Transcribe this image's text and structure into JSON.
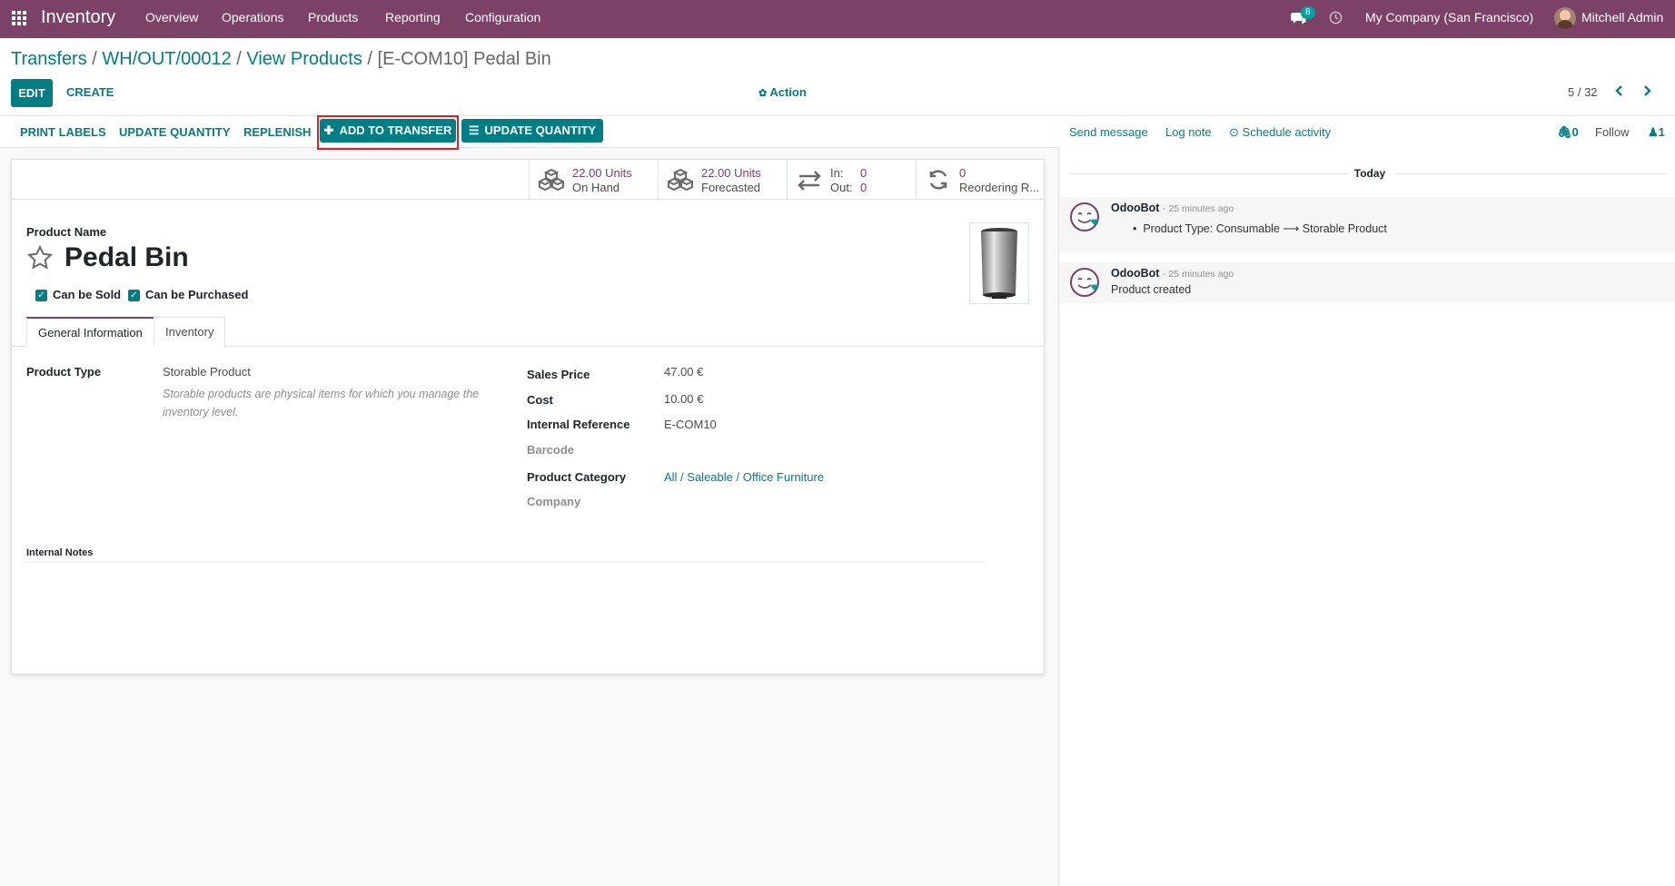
{
  "navbar": {
    "app_title": "Inventory",
    "menus": [
      "Overview",
      "Operations",
      "Products",
      "Reporting",
      "Configuration"
    ],
    "messages_count": "8",
    "company": "My Company (San Francisco)",
    "user": "Mitchell Admin"
  },
  "breadcrumb": {
    "items": [
      "Transfers",
      "WH/OUT/00012",
      "View Products"
    ],
    "current": "[E-COM10] Pedal Bin",
    "separator": "/"
  },
  "controls": {
    "edit": "EDIT",
    "create": "CREATE",
    "action": "Action",
    "pager": "5 / 32"
  },
  "statusbar": {
    "print_labels": "PRINT LABELS",
    "update_quantity": "UPDATE QUANTITY",
    "replenish": "REPLENISH",
    "add_to_transfer": "ADD TO TRANSFER",
    "update_quantity_primary": "UPDATE QUANTITY"
  },
  "stat_buttons": {
    "on_hand": {
      "value": "22.00 Units",
      "label": "On Hand"
    },
    "forecasted": {
      "value": "22.00 Units",
      "label": "Forecasted"
    },
    "in_out": {
      "in_label": "In:",
      "in_value": "0",
      "out_label": "Out:",
      "out_value": "0"
    },
    "reordering": {
      "value": "0",
      "label": "Reordering R..."
    }
  },
  "product": {
    "name_label": "Product Name",
    "name": "Pedal Bin",
    "can_be_sold": "Can be Sold",
    "can_be_purchased": "Can be Purchased"
  },
  "tabs": [
    "General Information",
    "Inventory"
  ],
  "general": {
    "product_type_label": "Product Type",
    "product_type": "Storable Product",
    "product_type_help_1": "Storable products are physical items for which you manage the",
    "product_type_help_2": "inventory level.",
    "sales_price_label": "Sales Price",
    "sales_price": "47.00 €",
    "cost_label": "Cost",
    "cost": "10.00 €",
    "internal_ref_label": "Internal Reference",
    "internal_ref": "E-COM10",
    "barcode_label": "Barcode",
    "category_label": "Product Category",
    "category": "All / Saleable / Office Furniture",
    "company_label": "Company",
    "notes_label": "Internal Notes"
  },
  "chatter": {
    "send_message": "Send message",
    "log_note": "Log note",
    "schedule_activity": "Schedule activity",
    "attachments": "0",
    "follow": "Follow",
    "followers": "1",
    "today": "Today",
    "messages": [
      {
        "author": "OdooBot",
        "time": "- 25 minutes ago",
        "change_from": "Product Type: Consumable",
        "change_to": "Storable Product"
      },
      {
        "author": "OdooBot",
        "time": "- 25 minutes ago",
        "body": "Product created"
      }
    ]
  },
  "colors": {
    "brand": "#7c4167",
    "accent": "#017e84",
    "highlight": "#e02020"
  }
}
